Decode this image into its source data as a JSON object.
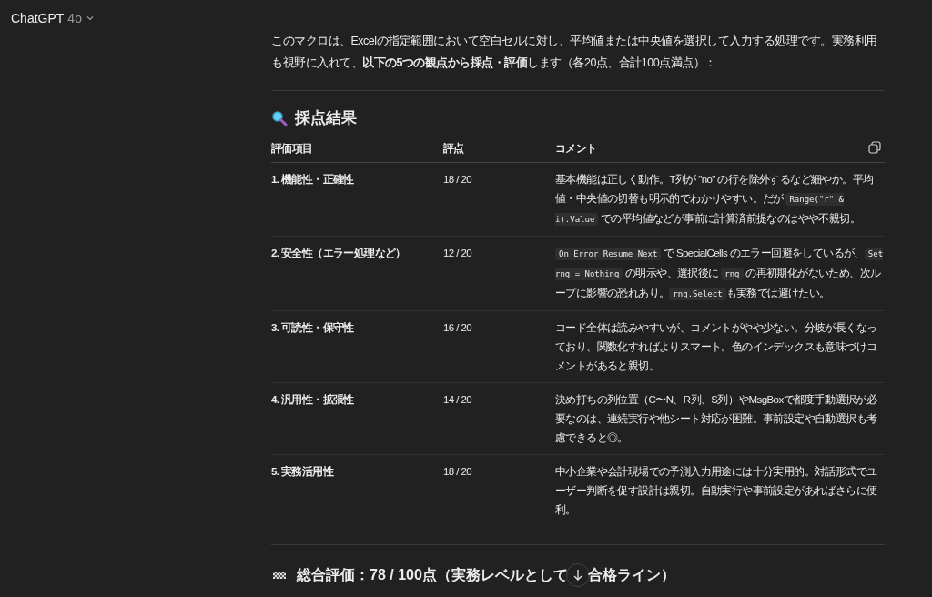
{
  "header": {
    "title": "ChatGPT",
    "model": "4o"
  },
  "intro": "このマクロは、Excelの指定範囲において空白セルに対し、平均値または中央値を選択して入力する処理です。実務利用も視野に入れて、**以下の5つの観点から採点・評価**します（各20点、合計100点満点）：",
  "section_heading": "採点結果",
  "table": {
    "columns": [
      "評価項目",
      "評点",
      "コメント"
    ],
    "rows": [
      {
        "item": "1. 機能性・正確性",
        "score": "18 / 20",
        "comment": [
          {
            "kind": "text",
            "text": "基本機能は正しく動作。T列が \"no\" の行を除外するなど細やか。平均値・中央値の切替も明示的でわかりやすい。だが "
          },
          {
            "kind": "code",
            "text": "Range(\"r\" & i).Value"
          },
          {
            "kind": "text",
            "text": " での平均値などが事前に計算済前提なのはやや不親切。"
          }
        ]
      },
      {
        "item": "2. 安全性（エラー処理など）",
        "score": "12 / 20",
        "comment": [
          {
            "kind": "code",
            "text": "On Error Resume Next"
          },
          {
            "kind": "text",
            "text": " で SpecialCells のエラー回避をしているが、"
          },
          {
            "kind": "code",
            "text": "Set rng = Nothing"
          },
          {
            "kind": "text",
            "text": " の明示や、選択後に "
          },
          {
            "kind": "code",
            "text": "rng"
          },
          {
            "kind": "text",
            "text": " の再初期化がないため、次ループに影響の恐れあり。"
          },
          {
            "kind": "code",
            "text": "rng.Select"
          },
          {
            "kind": "text",
            "text": "も実務では避けたい。"
          }
        ]
      },
      {
        "item": "3. 可読性・保守性",
        "score": "16 / 20",
        "comment": [
          {
            "kind": "text",
            "text": "コード全体は読みやすいが、コメントがやや少ない。分岐が長くなっており、関数化すればよりスマート。色のインデックスも意味づけコメントがあると親切。"
          }
        ]
      },
      {
        "item": "4. 汎用性・拡張性",
        "score": "14 / 20",
        "comment": [
          {
            "kind": "text",
            "text": "決め打ちの列位置（C〜N、R列、S列）やMsgBoxで都度手動選択が必要なのは、連続実行や他シート対応が困難。事前設定や自動選択も考慮できると◎。"
          }
        ]
      },
      {
        "item": "5. 実務活用性",
        "score": "18 / 20",
        "comment": [
          {
            "kind": "text",
            "text": "中小企業や会計現場での予測入力用途には十分実用的。対話形式でユーザー判断を促す設計は親切。自動実行や事前設定があればさらに便利。"
          }
        ]
      }
    ]
  },
  "summary_heading": {
    "before": "総合評価：78 / 100点（実務レベルとして",
    "after": "合格ライン）"
  }
}
